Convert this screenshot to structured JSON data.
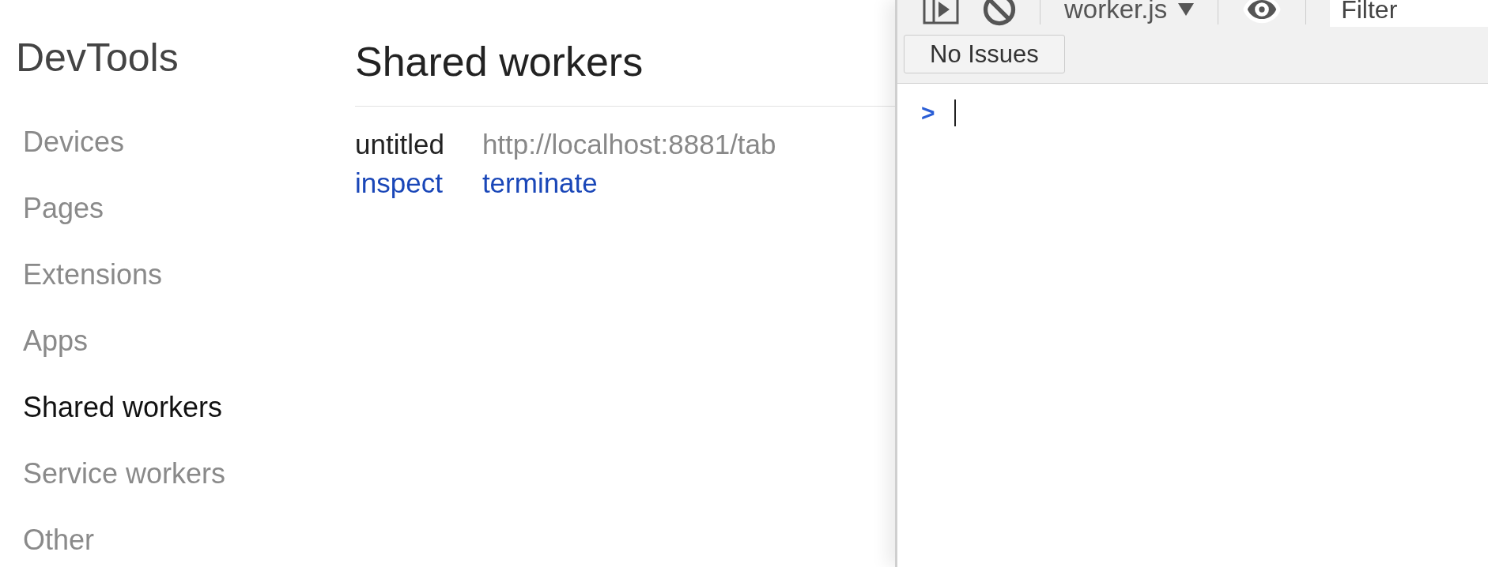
{
  "sidebar": {
    "title": "DevTools",
    "items": [
      {
        "label": "Devices",
        "selected": false
      },
      {
        "label": "Pages",
        "selected": false
      },
      {
        "label": "Extensions",
        "selected": false
      },
      {
        "label": "Apps",
        "selected": false
      },
      {
        "label": "Shared workers",
        "selected": true
      },
      {
        "label": "Service workers",
        "selected": false
      },
      {
        "label": "Other",
        "selected": false
      }
    ]
  },
  "main": {
    "heading": "Shared workers",
    "workers": [
      {
        "name": "untitled",
        "url": "http://localhost:8881/tab",
        "actions": [
          "inspect",
          "terminate"
        ]
      }
    ]
  },
  "console": {
    "context": "worker.js",
    "filter": {
      "placeholder": "Filter"
    },
    "issues_button": "No Issues",
    "prompt": ">"
  }
}
